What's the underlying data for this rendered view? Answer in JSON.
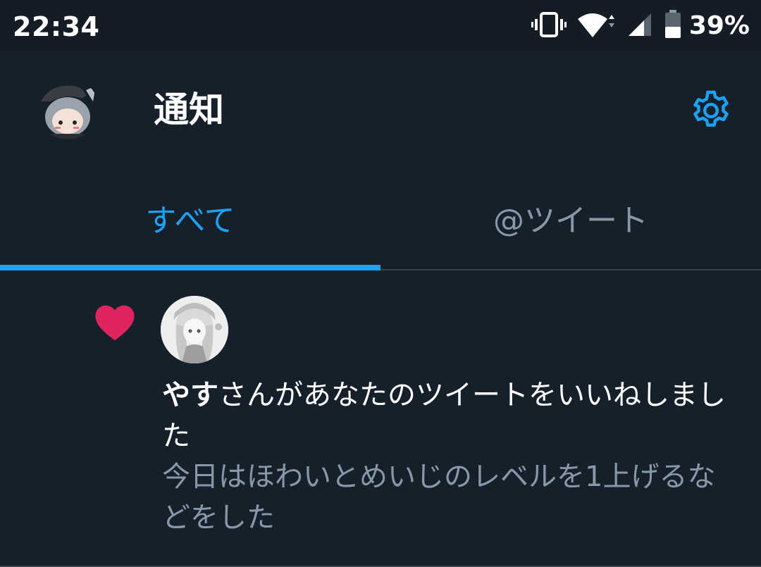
{
  "status_bar": {
    "time": "22:34",
    "battery_percent": "39%",
    "icons": [
      "vibrate-icon",
      "wifi-icon",
      "cell-signal-icon",
      "battery-icon"
    ]
  },
  "header": {
    "title": "通知",
    "avatar": "profile-avatar",
    "settings_icon": "gear-icon"
  },
  "tabs": [
    {
      "label": "すべて",
      "active": true
    },
    {
      "label": "@ツイート",
      "active": false
    }
  ],
  "notifications": [
    {
      "type": "like",
      "icon": "heart-icon",
      "user_avatar": "user-avatar",
      "username": "やす",
      "message": "さんがあなたのツイートをいいねしました",
      "tweet_preview": "今日はほわいとめいじのレベルを1上げるなどをした"
    }
  ],
  "colors": {
    "background": "#15202b",
    "status_bar": "#141d26",
    "accent": "#1da1f2",
    "heart": "#e0245e",
    "secondary_text": "#8899a6",
    "divider": "#38444d"
  }
}
